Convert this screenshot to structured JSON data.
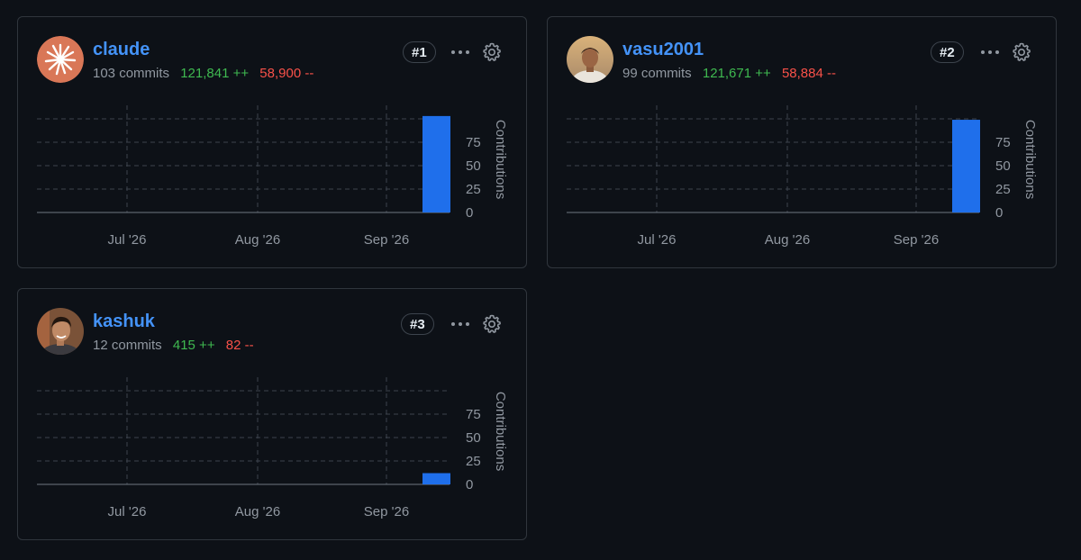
{
  "contributors": [
    {
      "username": "claude",
      "commits": "103 commits",
      "additions": "121,841 ++",
      "deletions": "58,900 --",
      "rank": "#1",
      "avatar": "claude-logo-avatar",
      "chart_data": {
        "type": "bar",
        "x_ticks": [
          "Jul '26",
          "Aug '26",
          "Sep '26"
        ],
        "y_ticks": [
          "0",
          "25",
          "50",
          "75"
        ],
        "ylabel": "Contributions",
        "ylim": [
          0,
          100
        ],
        "values": [
          103
        ],
        "bar_period": "last week of Sep '26"
      }
    },
    {
      "username": "vasu2001",
      "commits": "99 commits",
      "additions": "121,671 ++",
      "deletions": "58,884 --",
      "rank": "#2",
      "avatar": "person-photo-avatar",
      "chart_data": {
        "type": "bar",
        "x_ticks": [
          "Jul '26",
          "Aug '26",
          "Sep '26"
        ],
        "y_ticks": [
          "0",
          "25",
          "50",
          "75"
        ],
        "ylabel": "Contributions",
        "ylim": [
          0,
          100
        ],
        "values": [
          99
        ],
        "bar_period": "last week of Sep '26"
      }
    },
    {
      "username": "kashuk",
      "commits": "12 commits",
      "additions": "415 ++",
      "deletions": "82 --",
      "rank": "#3",
      "avatar": "person-photo-avatar",
      "chart_data": {
        "type": "bar",
        "x_ticks": [
          "Jul '26",
          "Aug '26",
          "Sep '26"
        ],
        "y_ticks": [
          "0",
          "25",
          "50",
          "75"
        ],
        "ylabel": "Contributions",
        "ylim": [
          0,
          100
        ],
        "values": [
          12
        ],
        "bar_period": "last week of Sep '26"
      }
    }
  ],
  "colors": {
    "background": "#0d1117",
    "border": "#30363d",
    "username": "#4493f8",
    "additions": "#3fb950",
    "deletions": "#f85149",
    "bar": "#1f6feb",
    "muted": "#9198a1"
  },
  "icons": {
    "menu": "kebab-horizontal-icon",
    "settings": "gear-icon"
  }
}
